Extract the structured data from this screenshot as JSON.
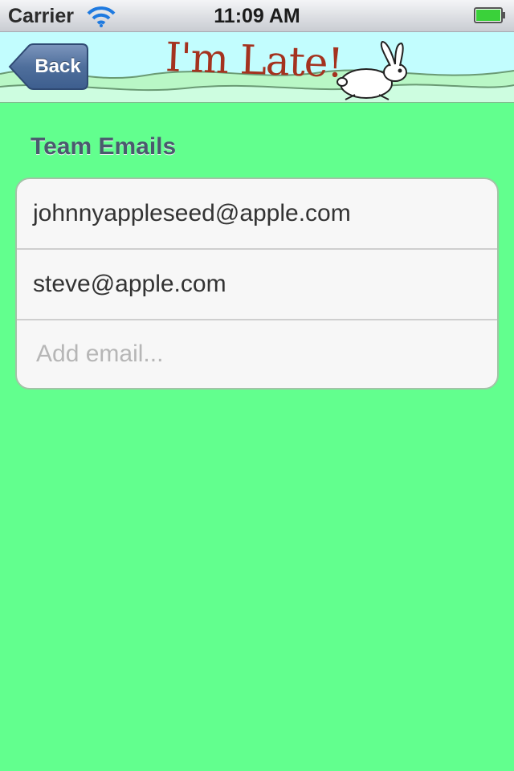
{
  "status_bar": {
    "carrier": "Carrier",
    "time": "11:09 AM",
    "wifi_icon": "wifi-icon",
    "battery_icon": "battery-full-icon",
    "battery_color": "#3ad13a"
  },
  "nav_bar": {
    "back_label": "Back",
    "logo_text": "I'm Late!",
    "logo_color": "#a4321f",
    "background": "#c2fdfe",
    "rabbit_icon": "rabbit-icon"
  },
  "section": {
    "title": "Team Emails"
  },
  "emails": [
    {
      "address": "johnnyappleseed@apple.com"
    },
    {
      "address": "steve@apple.com"
    }
  ],
  "add_email": {
    "placeholder": "Add email...",
    "value": ""
  },
  "colors": {
    "page_background": "#62ff8e",
    "table_background": "#f7f7f7",
    "back_button": "#4f6f9c",
    "section_title": "#4a5a6e"
  }
}
